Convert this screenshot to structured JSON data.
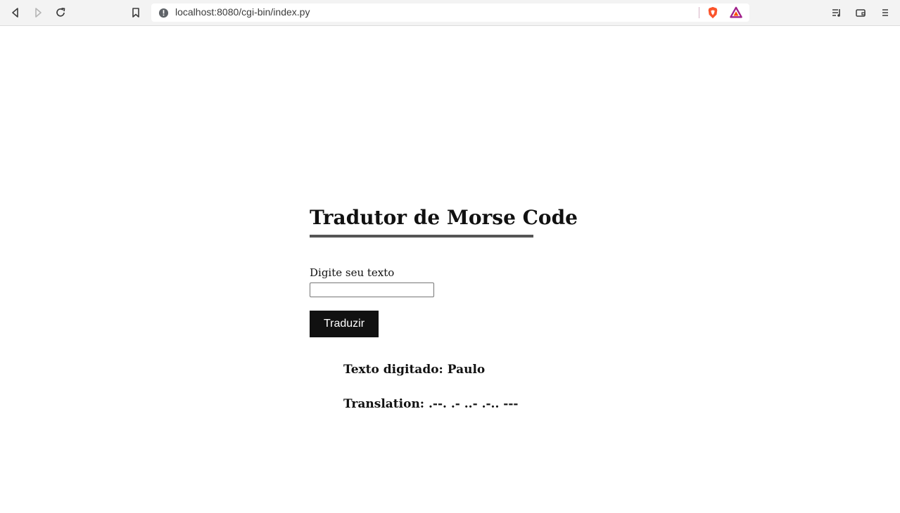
{
  "browser": {
    "url": "localhost:8080/cgi-bin/index.py",
    "icons": {
      "back": "back-arrow-icon",
      "forward": "forward-arrow-icon",
      "reload": "reload-icon",
      "bookmark": "bookmark-icon",
      "site_info": "info-icon",
      "brave_shields": "brave-shield-icon",
      "brave_rewards": "brave-rewards-icon",
      "reading_list": "reading-list-icon",
      "wallet": "wallet-icon",
      "menu": "menu-icon"
    },
    "colors": {
      "shield": "#fb542b",
      "rewards_a": "#a0208b",
      "rewards_b": "#ff5000"
    }
  },
  "page": {
    "title": "Tradutor de Morse Code",
    "input_label": "Digite seu texto",
    "input_value": "",
    "submit_label": "Traduzir",
    "typed_text_line": "Texto digitado: Paulo",
    "translation_line": "Translation: .--. .- ..- .-.. ---"
  }
}
